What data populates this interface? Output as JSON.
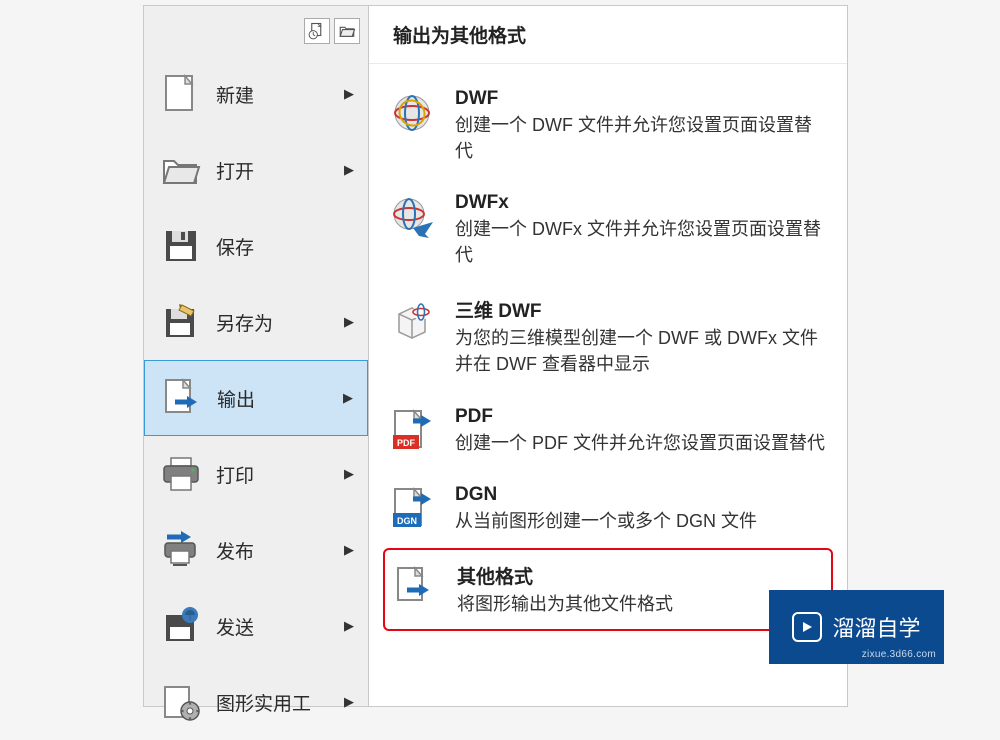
{
  "menu": {
    "items": [
      {
        "label": "新建",
        "has_sub": true
      },
      {
        "label": "打开",
        "has_sub": true
      },
      {
        "label": "保存",
        "has_sub": false
      },
      {
        "label": "另存为",
        "has_sub": true
      },
      {
        "label": "输出",
        "has_sub": true
      },
      {
        "label": "打印",
        "has_sub": true
      },
      {
        "label": "发布",
        "has_sub": true
      },
      {
        "label": "发送",
        "has_sub": true
      },
      {
        "label": "图形实用工",
        "has_sub": true
      }
    ],
    "selected_index": 4
  },
  "flyout": {
    "title": "输出为其他格式",
    "items": [
      {
        "name": "DWF",
        "desc": "创建一个 DWF 文件并允许您设置页面设置替代"
      },
      {
        "name": "DWFx",
        "desc": "创建一个 DWFx 文件并允许您设置页面设置替代"
      },
      {
        "name": "三维 DWF",
        "desc": "为您的三维模型创建一个 DWF 或 DWFx 文件并在 DWF 查看器中显示"
      },
      {
        "name": "PDF",
        "desc": "创建一个 PDF 文件并允许您设置页面设置替代"
      },
      {
        "name": "DGN",
        "desc": "从当前图形创建一个或多个 DGN 文件"
      },
      {
        "name": "其他格式",
        "desc": "将图形输出为其他文件格式"
      }
    ],
    "highlight_index": 5
  },
  "watermark": {
    "brand": "溜溜自学",
    "url": "zixue.3d66.com"
  }
}
